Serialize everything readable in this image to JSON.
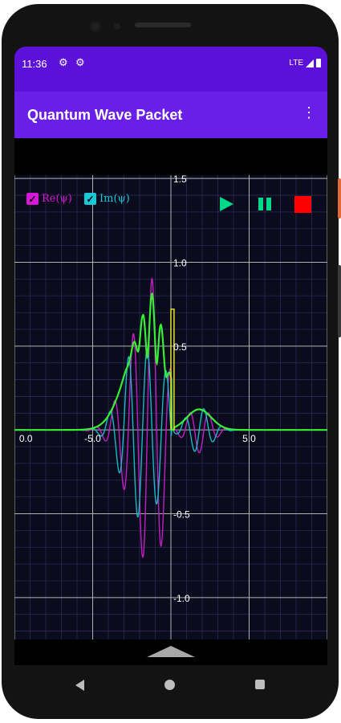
{
  "status_bar": {
    "time": "11:36",
    "network": "LTE",
    "icons": [
      "gear-icon",
      "gear-icon",
      "signal-icon",
      "battery-icon"
    ]
  },
  "app_bar": {
    "title": "Quantum Wave Packet",
    "menu_icon": "overflow-menu-icon"
  },
  "legend": [
    {
      "label": "Re(ψ)",
      "checked": true,
      "color": "#d619d6"
    },
    {
      "label": "Im(ψ)",
      "checked": true,
      "color": "#19c7d6"
    }
  ],
  "controls": [
    {
      "name": "play",
      "icon": "play-icon",
      "color": "#00d88a"
    },
    {
      "name": "pause",
      "icon": "pause-icon",
      "color": "#00d88a"
    },
    {
      "name": "stop",
      "icon": "stop-icon",
      "color": "#ff0000"
    }
  ],
  "chart_data": {
    "type": "line",
    "x_tick_labels": [
      "0.0",
      "-5.0",
      "5.0"
    ],
    "y_tick_labels": [
      "1.5",
      "1.0",
      "0.5",
      "-0.5",
      "-1.0"
    ],
    "xlim": [
      -10,
      10
    ],
    "ylim": [
      -1.25,
      1.52
    ],
    "grid": true,
    "series": [
      {
        "name": "Re(ψ)",
        "color": "#c21fc2",
        "center": -1.8,
        "width": 1.6,
        "k": 5.2,
        "amp": 0.62,
        "phase": 0.0
      },
      {
        "name": "Im(ψ)",
        "color": "#18b8c4",
        "center": -1.8,
        "width": 1.6,
        "k": 5.2,
        "amp": 0.62,
        "phase": 1.5708
      },
      {
        "name": "|ψ|",
        "color": "#38ef34",
        "center": -1.8,
        "width": 1.6,
        "k": 5.2,
        "amp": 0.62
      },
      {
        "name": "barrier",
        "color": "#e4e42a",
        "x_start": 0.0,
        "x_end": 0.2,
        "height": 0.72
      }
    ]
  },
  "colors": {
    "status_bar": "#5c11d8",
    "app_bar": "#6a1fe8",
    "plot_bg": "#0b0b1e",
    "grid": "#2a2a55",
    "grid_major": "#b0b0b0"
  }
}
